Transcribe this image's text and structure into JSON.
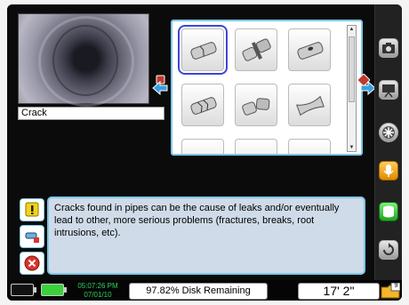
{
  "preview": {
    "caption": "Crack"
  },
  "observation_icons": [
    {
      "name": "crack-pipe-icon",
      "selected": true
    },
    {
      "name": "joint-offset-icon",
      "selected": false
    },
    {
      "name": "hole-pipe-icon",
      "selected": false
    },
    {
      "name": "fracture-pipe-icon",
      "selected": false
    },
    {
      "name": "broken-pipe-icon",
      "selected": false
    },
    {
      "name": "deformed-pipe-icon",
      "selected": false
    },
    {
      "name": "pipe-partial-1-icon",
      "selected": false
    },
    {
      "name": "pipe-partial-2-icon",
      "selected": false
    },
    {
      "name": "pipe-partial-3-icon",
      "selected": false
    }
  ],
  "description": {
    "text": "Cracks found in pipes can be the cause of leaks and/or eventually lead to other, more serious problems (fractures, breaks, root intrusions, etc)."
  },
  "toolbar": {
    "items": [
      "camera-icon",
      "projector-icon",
      "gear-icon",
      "microphone-icon",
      "storage-icon",
      "rotate-icon"
    ]
  },
  "status": {
    "time": "05:07:26 PM",
    "date": "07/01/10",
    "disk": "97.82% Disk Remaining",
    "distance": "17' 2\"",
    "folder_count": "9"
  },
  "colors": {
    "accent": "#7fc6e6",
    "selection": "#3b48d6",
    "clock": "#2ed05a",
    "battery_full": "#3bd13b",
    "description_bg": "#cfdbe8"
  }
}
